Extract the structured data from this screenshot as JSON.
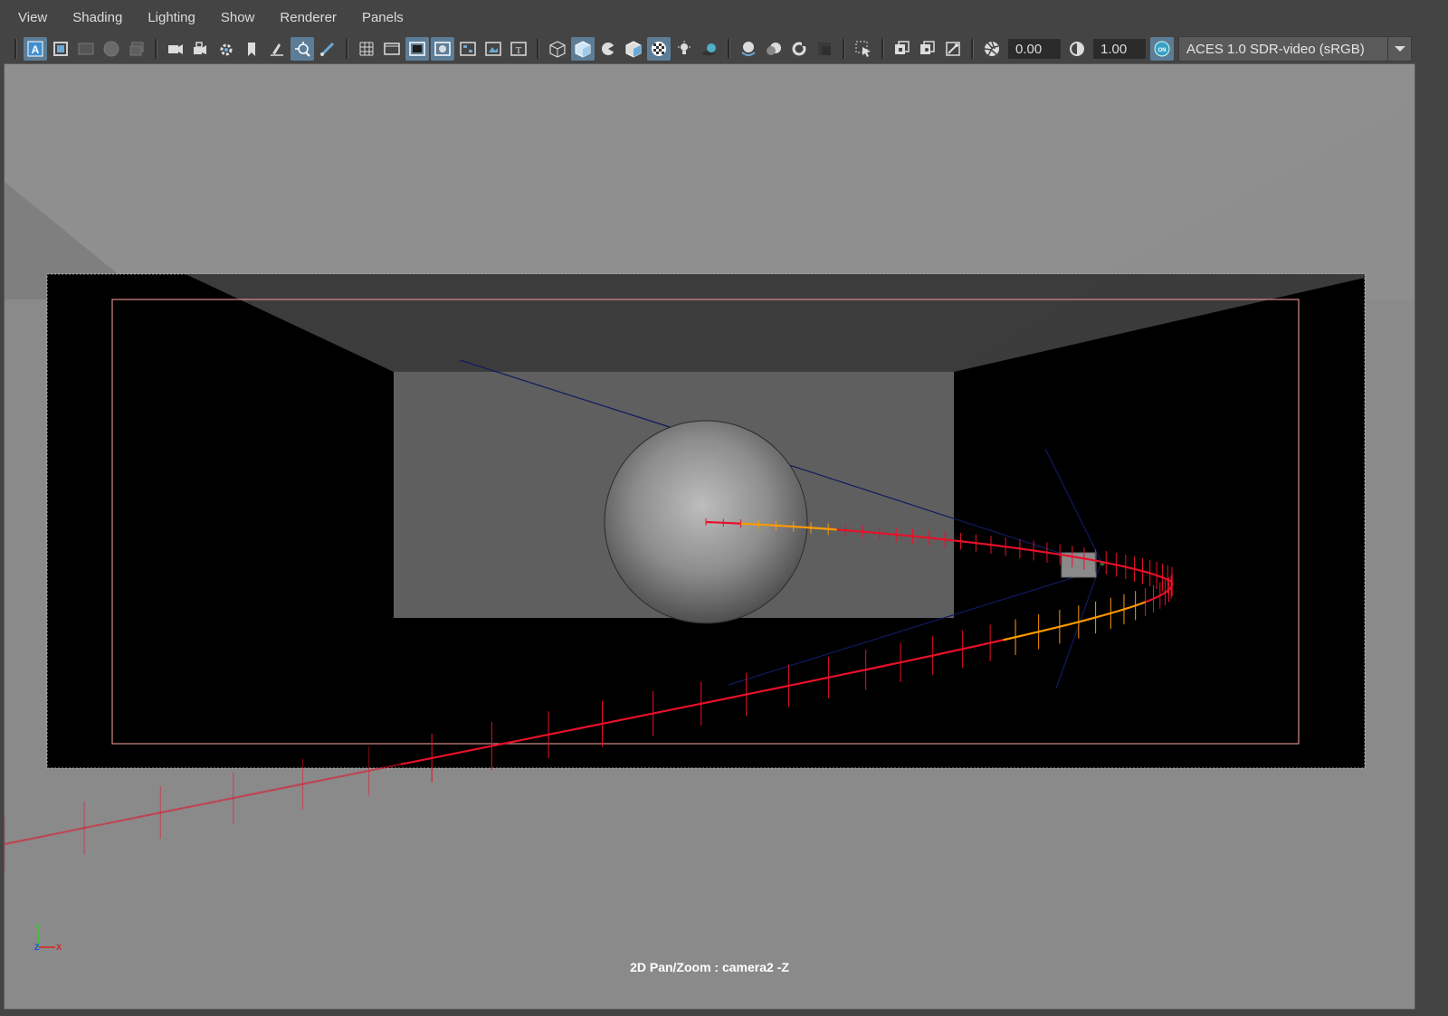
{
  "menubar": {
    "items": [
      "View",
      "Shading",
      "Lighting",
      "Show",
      "Renderer",
      "Panels"
    ]
  },
  "toolbar": {
    "icons_group1": [
      "select-camera-icon",
      "camera-attributes-icon",
      "image-plane-icon",
      "color-swatch-icon",
      "layers-icon"
    ],
    "icons_group2": [
      "camera-icon",
      "lock-camera-icon",
      "camera-settings-icon",
      "bookmark-icon",
      "grease-pencil-icon",
      "pan-zoom-icon",
      "brush-icon"
    ],
    "icons_group3": [
      "grid-icon",
      "film-gate-icon",
      "resolution-gate-icon",
      "gate-mask-icon",
      "field-chart-icon",
      "safe-action-icon",
      "safe-title-icon"
    ],
    "icons_group4": [
      "wireframe-icon",
      "smooth-shade-icon",
      "wire-on-shaded-icon",
      "textured-icon",
      "use-default-material-icon",
      "lights-icon",
      "shadows-icon"
    ],
    "icons_group5": [
      "screen-space-ao-icon",
      "motion-blur-icon",
      "anti-aliasing-icon",
      "depth-of-field-icon"
    ],
    "icons_group6": [
      "isolate-select-icon"
    ],
    "icons_group7": [
      "xray-icon",
      "xray-active-icon",
      "xray-joints-icon"
    ],
    "exposure_value": "0.00",
    "gamma_value": "1.00",
    "cm_toggle_label": "ON",
    "color_space": "ACES 1.0 SDR-video (sRGB)"
  },
  "viewport": {
    "hud_label": "2D Pan/Zoom : camera2 -Z",
    "axis_y": "Y",
    "axis_z": "Z",
    "axis_x": "X"
  },
  "colors": {
    "viewport_bg": "#8a8a8a",
    "gate_bg": "#000000",
    "room_top": "#3b3b3b",
    "room_back": "#5e5e5e",
    "motion_trail": "#e8102a",
    "motion_trail_fade": "#ff9a00",
    "safe_frame": "#d98a8a",
    "camera_lines": "#101a60",
    "toolbar_active": "#5d7d97"
  }
}
